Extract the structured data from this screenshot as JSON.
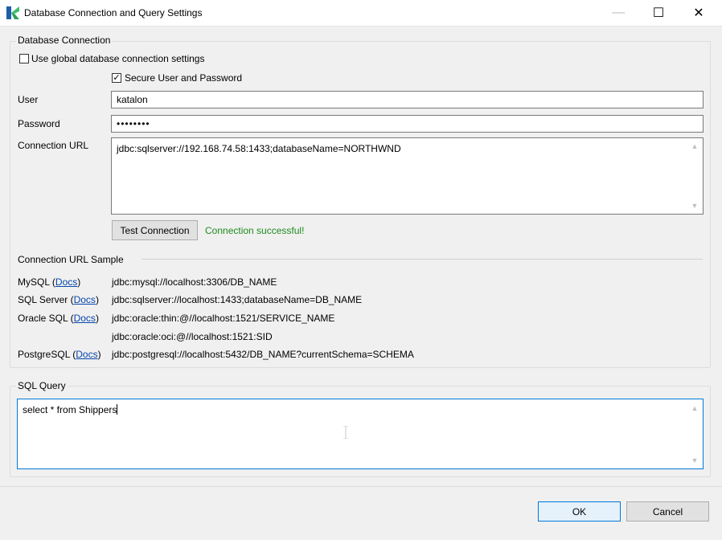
{
  "window": {
    "title": "Database Connection and Query Settings",
    "minimize_glyph": "—",
    "maximize_glyph": "☐",
    "close_glyph": "✕"
  },
  "database_connection": {
    "legend": "Database Connection",
    "use_global_label": "Use global database connection settings",
    "use_global_checked": false,
    "secure_label": "Secure User and Password",
    "secure_checked": true,
    "user_label": "User",
    "user_value": "katalon",
    "password_label": "Password",
    "password_value": "••••••••",
    "url_label": "Connection URL",
    "url_value": "jdbc:sqlserver://192.168.74.58:1433;databaseName=NORTHWND",
    "test_button": "Test Connection",
    "status": "Connection successful!",
    "status_color": "#1e8a1e"
  },
  "samples": {
    "header": "Connection URL Sample",
    "docs_label": "Docs",
    "rows": [
      {
        "name": "MySQL",
        "url": "jdbc:mysql://localhost:3306/DB_NAME"
      },
      {
        "name": "SQL Server",
        "url": "jdbc:sqlserver://localhost:1433;databaseName=DB_NAME"
      },
      {
        "name": "Oracle SQL",
        "url": "jdbc:oracle:thin:@//localhost:1521/SERVICE_NAME"
      },
      {
        "name": "",
        "url": "jdbc:oracle:oci:@//localhost:1521:SID"
      },
      {
        "name": "PostgreSQL",
        "url": "jdbc:postgresql://localhost:5432/DB_NAME?currentSchema=SCHEMA"
      }
    ]
  },
  "sql_query": {
    "legend": "SQL Query",
    "value": "select * from Shippers"
  },
  "footer": {
    "ok_label": "OK",
    "cancel_label": "Cancel"
  },
  "colors": {
    "link": "#0645ad",
    "focus_border": "#0078d7",
    "logo_green": "#3dbd6b",
    "logo_blue": "#1c5fa8"
  }
}
